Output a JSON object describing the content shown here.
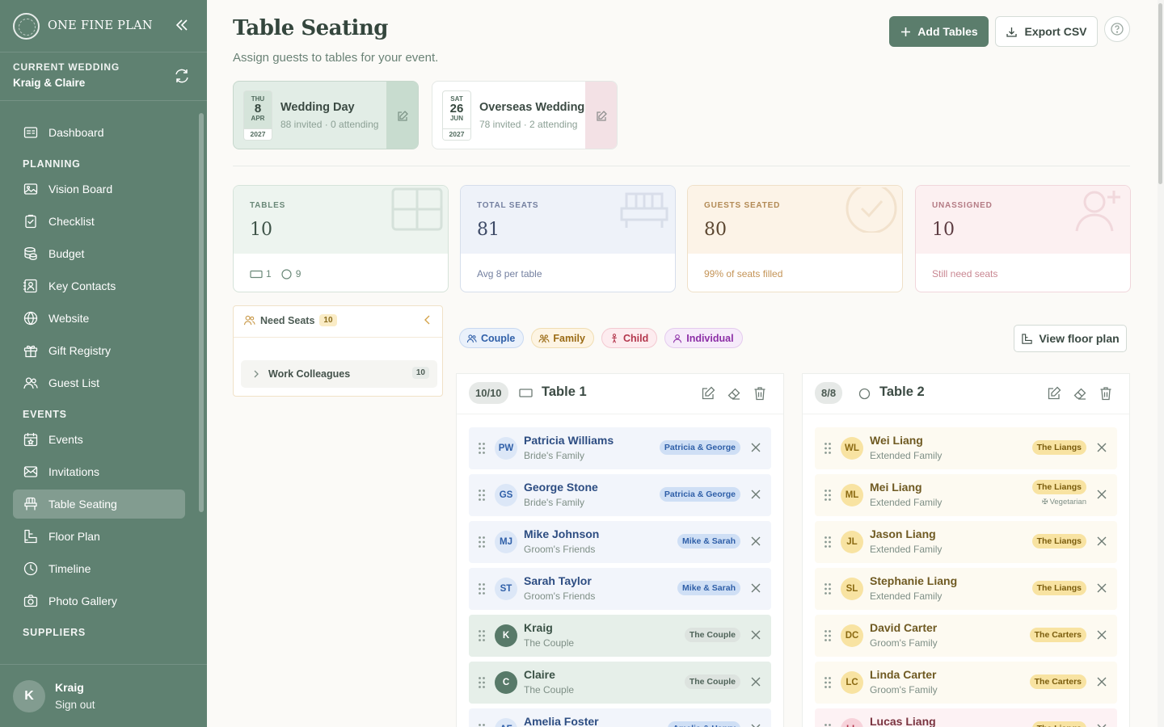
{
  "brand": {
    "name": "ONE FINE PLAN"
  },
  "current_wedding": {
    "label": "CURRENT WEDDING",
    "name": "Kraig & Claire"
  },
  "nav": [
    {
      "type": "item",
      "label": "Dashboard",
      "icon": "dashboard-icon"
    },
    {
      "type": "section",
      "label": "PLANNING"
    },
    {
      "type": "item",
      "label": "Vision Board",
      "icon": "image-icon"
    },
    {
      "type": "item",
      "label": "Checklist",
      "icon": "clipboard-check-icon"
    },
    {
      "type": "item",
      "label": "Budget",
      "icon": "coins-icon"
    },
    {
      "type": "item",
      "label": "Key Contacts",
      "icon": "contact-icon"
    },
    {
      "type": "item",
      "label": "Website",
      "icon": "globe-icon"
    },
    {
      "type": "item",
      "label": "Gift Registry",
      "icon": "gift-icon"
    },
    {
      "type": "item",
      "label": "Guest List",
      "icon": "users-icon"
    },
    {
      "type": "section",
      "label": "EVENTS"
    },
    {
      "type": "item",
      "label": "Events",
      "icon": "calendar-star-icon"
    },
    {
      "type": "item",
      "label": "Invitations",
      "icon": "mail-icon"
    },
    {
      "type": "item",
      "label": "Table Seating",
      "icon": "chair-icon",
      "active": true
    },
    {
      "type": "item",
      "label": "Floor Plan",
      "icon": "floor-plan-icon"
    },
    {
      "type": "item",
      "label": "Timeline",
      "icon": "clock-icon"
    },
    {
      "type": "item",
      "label": "Photo Gallery",
      "icon": "camera-icon"
    },
    {
      "type": "section",
      "label": "SUPPLIERS"
    }
  ],
  "user": {
    "initial": "K",
    "name": "Kraig",
    "signout": "Sign out"
  },
  "header": {
    "title": "Table Seating",
    "subtitle": "Assign guests to tables for your event.",
    "add_tables": "Add Tables",
    "export_csv": "Export CSV"
  },
  "events": [
    {
      "dow": "THU",
      "day": "8",
      "mon": "APR",
      "yr": "2027",
      "name": "Wedding Day",
      "meta": "88 invited · 0 attending",
      "active": true
    },
    {
      "dow": "SAT",
      "day": "26",
      "mon": "JUN",
      "yr": "2027",
      "name": "Overseas Wedding",
      "meta": "78 invited · 2 attending",
      "active": false
    }
  ],
  "stats": {
    "tables": {
      "label": "TABLES",
      "value": "10",
      "rect_count": "1",
      "round_count": "9"
    },
    "seats": {
      "label": "TOTAL SEATS",
      "value": "81",
      "foot": "Avg 8 per table"
    },
    "seated": {
      "label": "GUESTS SEATED",
      "value": "80",
      "foot": "99% of seats filled"
    },
    "unassigned": {
      "label": "UNASSIGNED",
      "value": "10",
      "foot": "Still need seats"
    }
  },
  "need_seats": {
    "title": "Need Seats",
    "count": "10",
    "group": {
      "name": "Work Colleagues",
      "count": "10"
    }
  },
  "legend": [
    {
      "label": "Couple",
      "icon": "couple-icon",
      "color": "#2f5fa8",
      "bg": "#eaf1fb",
      "border": "#c9d9f1"
    },
    {
      "label": "Family",
      "icon": "family-icon",
      "color": "#9a6a13",
      "bg": "#fdf4e3",
      "border": "#f0ddb2"
    },
    {
      "label": "Child",
      "icon": "child-icon",
      "color": "#b3364c",
      "bg": "#fdecef",
      "border": "#f3c9d1"
    },
    {
      "label": "Individual",
      "icon": "person-icon",
      "color": "#8c2ea6",
      "bg": "#f6ebfa",
      "border": "#e4cbee"
    }
  ],
  "floor_plan_btn": "View floor plan",
  "tables": [
    {
      "badge": "10/10",
      "name": "Table 1",
      "shape": "rect",
      "guests": [
        {
          "initials": "PW",
          "name": "Patricia Williams",
          "group": "Bride's Family",
          "tag": "Patricia & George",
          "theme": "blue"
        },
        {
          "initials": "GS",
          "name": "George Stone",
          "group": "Bride's Family",
          "tag": "Patricia & George",
          "theme": "blue"
        },
        {
          "initials": "MJ",
          "name": "Mike Johnson",
          "group": "Groom's Friends",
          "tag": "Mike & Sarah",
          "theme": "blue"
        },
        {
          "initials": "ST",
          "name": "Sarah Taylor",
          "group": "Groom's Friends",
          "tag": "Mike & Sarah",
          "theme": "blue"
        },
        {
          "initials": "K",
          "name": "Kraig",
          "group": "The Couple",
          "tag": "The Couple",
          "theme": "green"
        },
        {
          "initials": "C",
          "name": "Claire",
          "group": "The Couple",
          "tag": "The Couple",
          "theme": "green"
        },
        {
          "initials": "AF",
          "name": "Amelia Foster",
          "group": "",
          "tag": "Amelia & Henry",
          "theme": "blue"
        }
      ]
    },
    {
      "badge": "8/8",
      "name": "Table 2",
      "shape": "round",
      "guests": [
        {
          "initials": "WL",
          "name": "Wei Liang",
          "group": "Extended Family",
          "tag": "The Liangs",
          "theme": "yellow"
        },
        {
          "initials": "ML",
          "name": "Mei Liang",
          "group": "Extended Family",
          "tag": "The Liangs",
          "theme": "yellow",
          "diet": "Vegetarian"
        },
        {
          "initials": "JL",
          "name": "Jason Liang",
          "group": "Extended Family",
          "tag": "The Liangs",
          "theme": "yellow"
        },
        {
          "initials": "SL",
          "name": "Stephanie Liang",
          "group": "Extended Family",
          "tag": "The Liangs",
          "theme": "yellow"
        },
        {
          "initials": "DC",
          "name": "David Carter",
          "group": "Groom's Family",
          "tag": "The Carters",
          "theme": "yellow"
        },
        {
          "initials": "LC",
          "name": "Linda Carter",
          "group": "Groom's Family",
          "tag": "The Carters",
          "theme": "yellow"
        },
        {
          "initials": "LL",
          "name": "Lucas Liang",
          "group": "",
          "tag": "The Liangs",
          "theme": "pink"
        }
      ]
    }
  ]
}
